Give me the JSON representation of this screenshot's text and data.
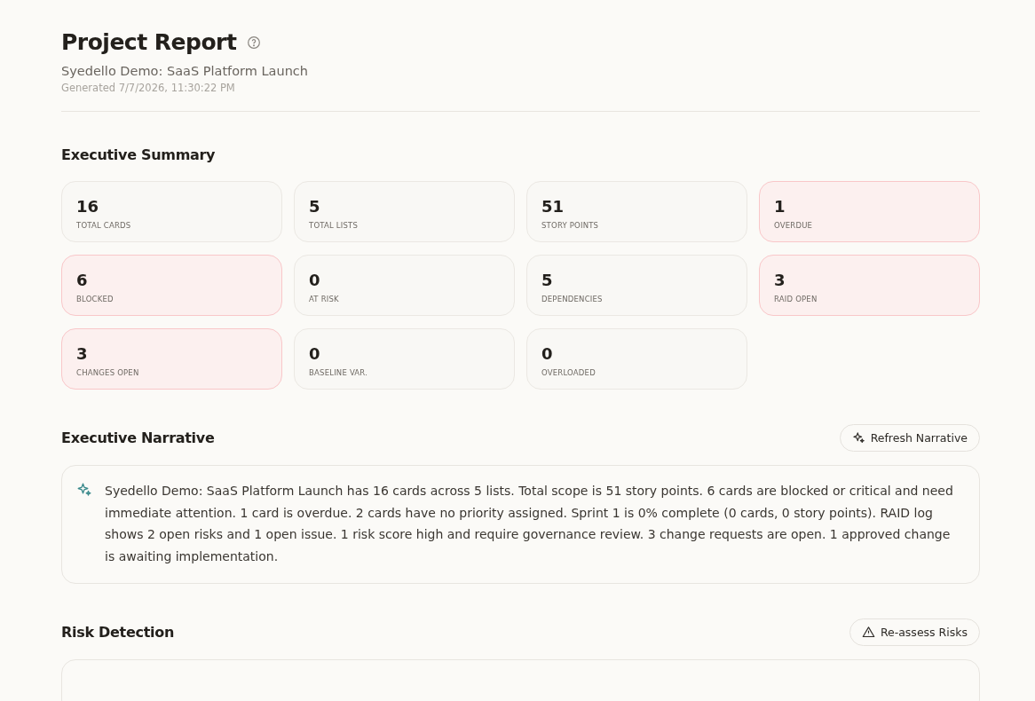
{
  "header": {
    "title": "Project Report",
    "subtitle": "Syedello Demo: SaaS Platform Launch",
    "generated": "Generated 7/7/2026, 11:30:22 PM"
  },
  "executive_summary": {
    "heading": "Executive Summary",
    "metrics": [
      {
        "value": "16",
        "label": "TOTAL CARDS",
        "alert": false
      },
      {
        "value": "5",
        "label": "TOTAL LISTS",
        "alert": false
      },
      {
        "value": "51",
        "label": "STORY POINTS",
        "alert": false
      },
      {
        "value": "1",
        "label": "OVERDUE",
        "alert": true
      },
      {
        "value": "6",
        "label": "BLOCKED",
        "alert": true
      },
      {
        "value": "0",
        "label": "AT RISK",
        "alert": false
      },
      {
        "value": "5",
        "label": "DEPENDENCIES",
        "alert": false
      },
      {
        "value": "3",
        "label": "RAID OPEN",
        "alert": true
      },
      {
        "value": "3",
        "label": "CHANGES OPEN",
        "alert": true
      },
      {
        "value": "0",
        "label": "BASELINE VAR.",
        "alert": false
      },
      {
        "value": "0",
        "label": "OVERLOADED",
        "alert": false
      }
    ]
  },
  "executive_narrative": {
    "heading": "Executive Narrative",
    "button": "Refresh Narrative",
    "text": "Syedello Demo: SaaS Platform Launch has 16 cards across 5 lists. Total scope is 51 story points. 6 cards are blocked or critical and need immediate attention. 1 card is overdue. 2 cards have no priority assigned. Sprint 1 is 0% complete (0 cards, 0 story points). RAID log shows 2 open risks and 1 open issue. 1 risk score high and require governance review. 3 change requests are open. 1 approved change is awaiting implementation."
  },
  "risk_detection": {
    "heading": "Risk Detection",
    "button": "Re-assess Risks"
  }
}
